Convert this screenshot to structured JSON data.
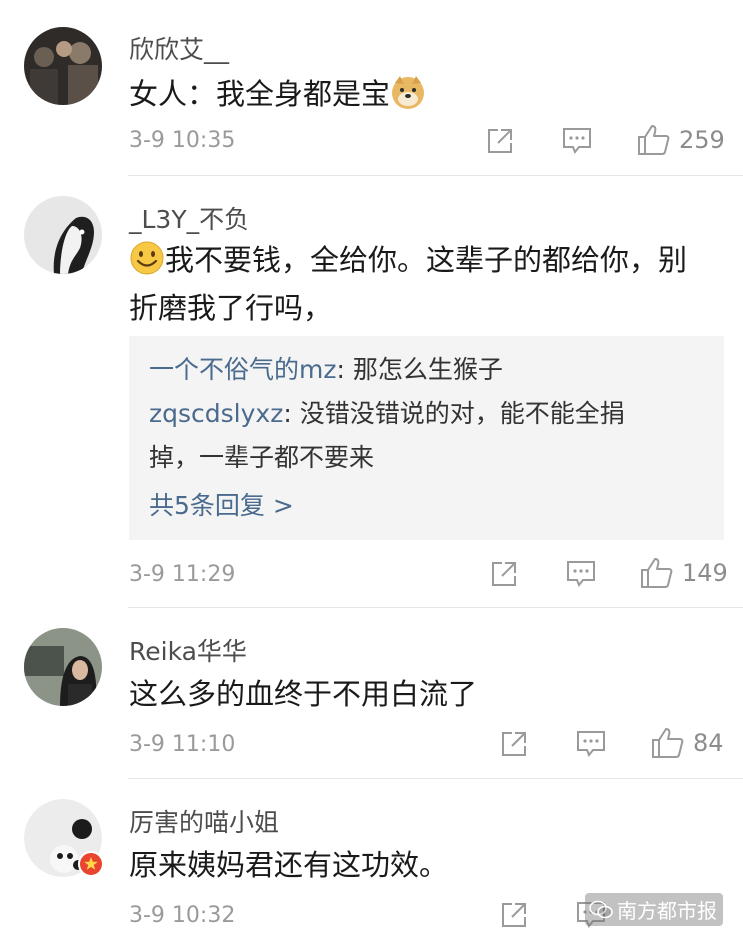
{
  "comments": [
    {
      "username": "欣欣艾__",
      "text": "女人：我全身都是宝",
      "time": "3-9 10:35",
      "likes": "259",
      "avatar_icon": "user-avatar-group-photo",
      "trailing_emoji": "doge-emoji-icon"
    },
    {
      "username": "_L3Y_不负",
      "text_line1": "我不要钱，全给你。这辈子的都给你，别",
      "text_line2": "折磨我了行吗，",
      "leading_emoji": "smile-emoji-icon",
      "replies": [
        {
          "name": "一个不俗气的mz",
          "sep": ": ",
          "text": "那怎么生猴子"
        },
        {
          "name": "zqscdslyxz",
          "sep": ": ",
          "text_line1": "没错没错说的对，能不能全捐",
          "text_line2": "掉，一辈子都不要来"
        }
      ],
      "more_replies": "共5条回复 >",
      "time": "3-9 11:29",
      "likes": "149",
      "avatar_icon": "user-avatar-dog"
    },
    {
      "username": "Reika华华",
      "text": "这么多的血终于不用白流了",
      "time": "3-9 11:10",
      "likes": "84",
      "avatar_icon": "user-avatar-woman"
    },
    {
      "username": "厉害的喵小姐",
      "text": "原来姨妈君还有这功效。",
      "time": "3-9 10:32",
      "avatar_icon": "user-avatar-panda",
      "badge_icon": "verified-badge-icon"
    }
  ],
  "watermark": "南方都市报",
  "colors": {
    "link": "#4a6a8e",
    "meta": "#9a9a9a",
    "reply_bg": "#f4f4f4"
  }
}
